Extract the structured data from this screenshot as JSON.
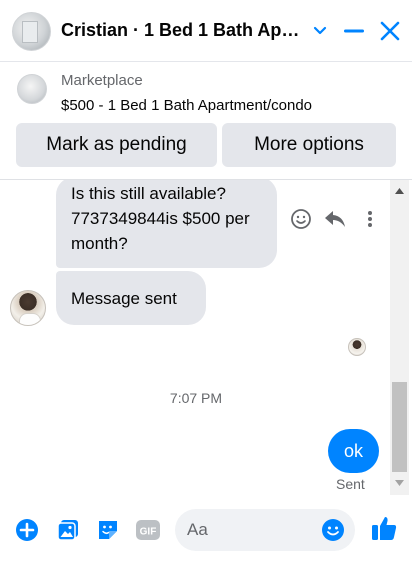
{
  "header": {
    "title": "Cristian · 1 Bed 1 Bath Apartment/condo",
    "icons": [
      "chevron-down-icon",
      "minimize-icon",
      "close-icon"
    ],
    "accent_color": "#0084ff"
  },
  "marketplace": {
    "label": "Marketplace",
    "listing": "$500 - 1 Bed 1 Bath Apartment/condo",
    "mark_pending_label": "Mark as pending",
    "more_options_label": "More options"
  },
  "messages": {
    "incoming_1": "Is this still available? 7737349844is $500 per month?",
    "incoming_2": "Message sent",
    "timestamp": "7:07 PM",
    "outgoing_1": "ok",
    "status": "Sent",
    "action_icons": [
      "smile-icon",
      "reply-icon",
      "more-icon"
    ]
  },
  "composer": {
    "placeholder": "Aa",
    "icons": [
      "plus-icon",
      "photo-icon",
      "sticker-icon",
      "gif-icon",
      "emoji-icon",
      "like-icon"
    ],
    "gif_label": "GIF"
  }
}
